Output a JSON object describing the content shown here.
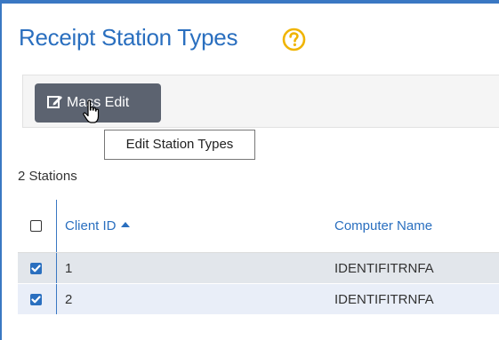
{
  "page": {
    "title": "Receipt Station Types",
    "help_icon": "question-circle-icon"
  },
  "toolbar": {
    "mass_edit_label": "Mass Edit",
    "mass_edit_icon": "edit-icon",
    "tooltip": "Edit Station Types"
  },
  "summary": {
    "count_text": "2 Stations"
  },
  "table": {
    "columns": [
      {
        "label": "Client ID",
        "sorted": "ascending"
      },
      {
        "label": "Computer Name"
      }
    ],
    "rows": [
      {
        "checked": true,
        "client_id": "1",
        "computer_name": "IDENTIFITRNFA"
      },
      {
        "checked": true,
        "client_id": "2",
        "computer_name": "IDENTIFITRNFA"
      }
    ]
  },
  "colors": {
    "accent": "#2a6fbf",
    "button_bg": "#5c6370",
    "help_icon": "#f0b400"
  }
}
